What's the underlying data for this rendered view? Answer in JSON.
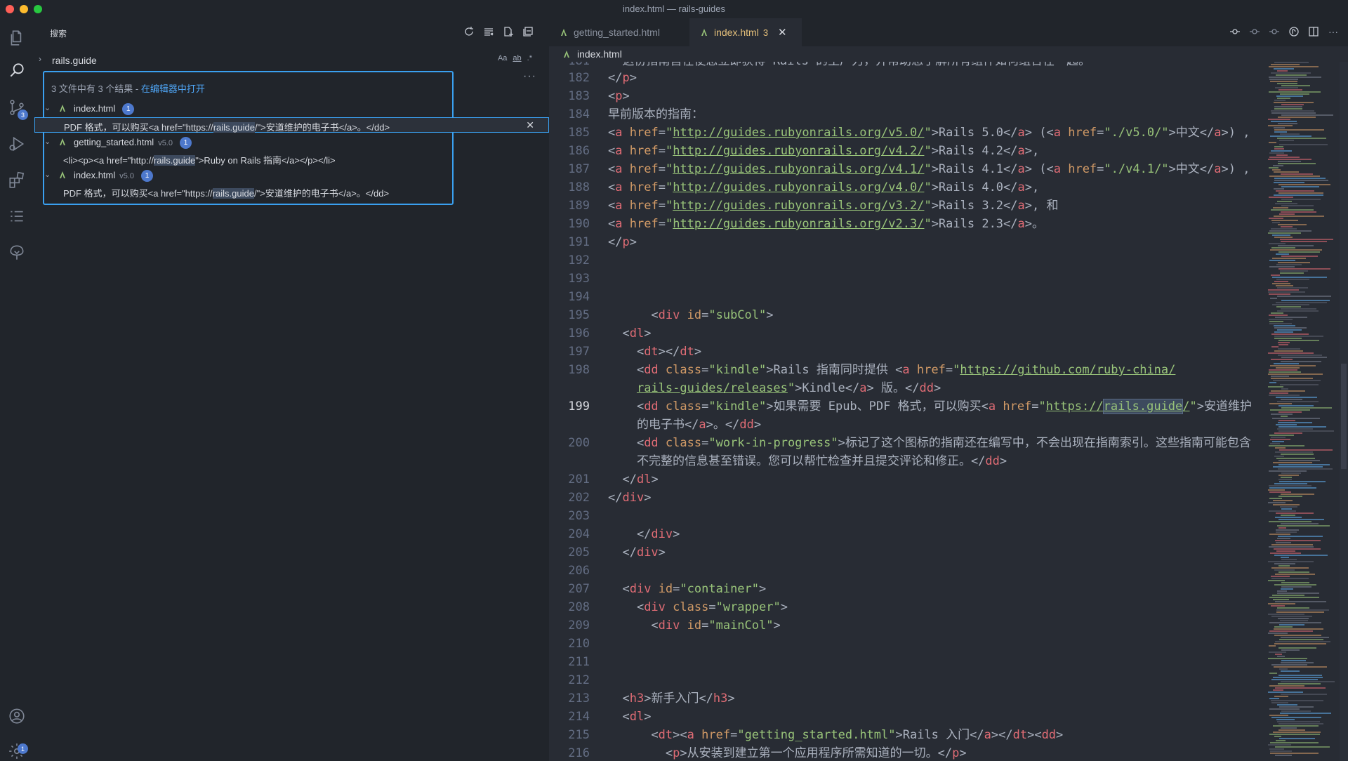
{
  "window": {
    "title": "index.html — rails-guides"
  },
  "activity": {
    "items": [
      "explorer-icon",
      "search-icon",
      "source-control-icon",
      "run-debug-icon",
      "extensions-icon",
      "outline-icon",
      "remote-tree-icon"
    ],
    "source_control_badge": "3",
    "settings_badge": "1"
  },
  "sidebar": {
    "header": "搜索",
    "search": {
      "value": "rails.guide",
      "opt_case": "Aa",
      "opt_word": "ab",
      "opt_regex": ".*"
    },
    "summary_text": "3 文件中有 3 个结果 - ",
    "summary_link": "在编辑器中打开",
    "results": [
      {
        "file": "index.html",
        "desc": "",
        "count": "1",
        "match_before": "PDF 格式，可以购买<a href=\"https://",
        "match_hit": "rails.guide",
        "match_after": "/\">安道维护的电子书</a>。</dd>"
      },
      {
        "file": "getting_started.html",
        "desc": "v5.0",
        "count": "1",
        "match_before": "<li><p><a href=\"http://",
        "match_hit": "rails.guide",
        "match_after": "\">Ruby on Rails 指南</a></p></li>"
      },
      {
        "file": "index.html",
        "desc": "v5.0",
        "count": "1",
        "match_before": "PDF 格式，可以购买<a href=\"https://",
        "match_hit": "rails.guide",
        "match_after": "/\">安道维护的电子书</a>。</dd>"
      }
    ]
  },
  "tabs": [
    {
      "label": "getting_started.html",
      "errors": ""
    },
    {
      "label": "index.html",
      "errors": "3"
    }
  ],
  "breadcrumb": "index.html",
  "editor": {
    "active_line": "199"
  }
}
